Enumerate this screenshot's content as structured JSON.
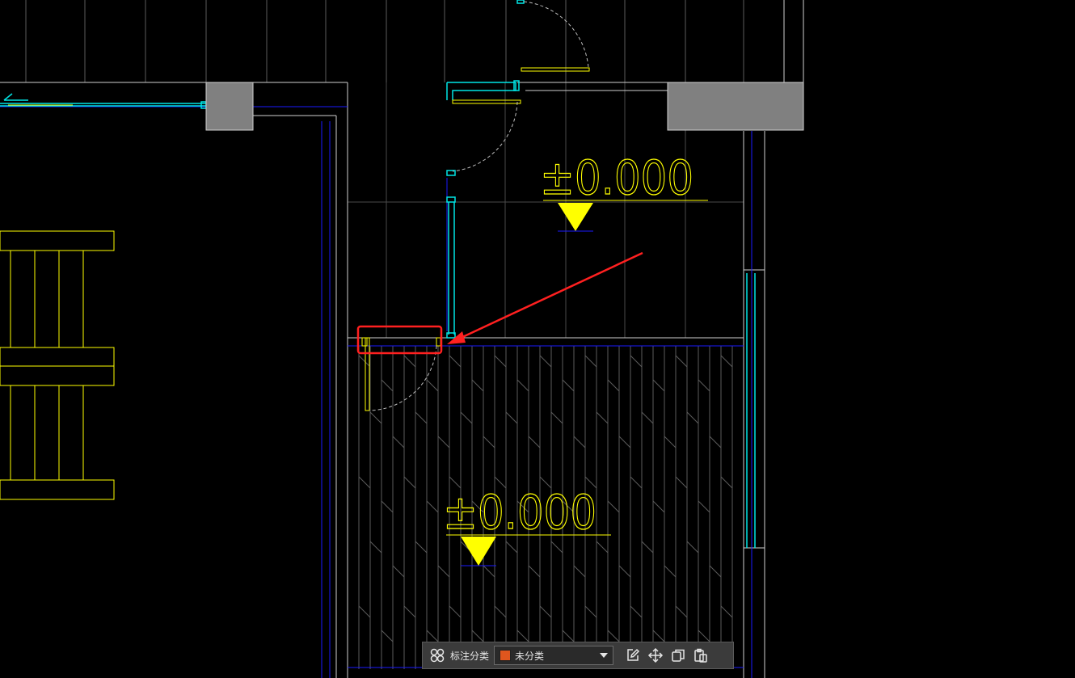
{
  "drawing": {
    "elevation_upper": "±0.000",
    "elevation_lower": "±0.000",
    "colors": {
      "background": "#000000",
      "wall": "#ffffff",
      "hatch": "#5c5c5c",
      "blue_line": "#1a1aff",
      "cyan_line": "#00e5e5",
      "yellow": "#ffff00",
      "column_fill": "#808080",
      "highlight": "#ff2020"
    }
  },
  "toolbar": {
    "label": "标注分类",
    "selected_category": "未分类",
    "category_color": "#e0561e",
    "icons": [
      "layout-grid-icon",
      "chevron-down-icon",
      "edit-icon",
      "move-icon",
      "copy-icon",
      "paste-icon"
    ]
  }
}
